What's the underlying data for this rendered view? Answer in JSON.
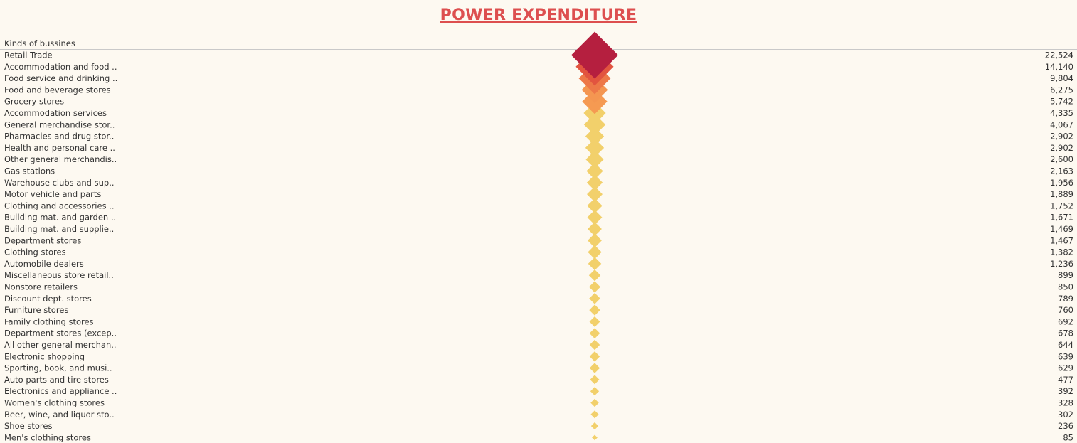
{
  "chart_data": {
    "type": "scatter",
    "title": "POWER EXPENDITURE",
    "column_header": "Kinds of bussines",
    "categories": [
      "Retail Trade",
      "Accommodation and food ..",
      "Food service and drinking ..",
      "Food and beverage stores",
      "Grocery stores",
      "Accommodation services",
      "General merchandise stor..",
      "Pharmacies and drug stor..",
      "Health and personal care ..",
      "Other general merchandis..",
      "Gas stations",
      "Warehouse clubs and sup..",
      "Motor vehicle and parts",
      "Clothing and accessories ..",
      "Building mat. and garden ..",
      "Building mat. and supplie..",
      "Department stores",
      "Clothing stores",
      "Automobile dealers",
      "Miscellaneous store retail..",
      "Nonstore retailers",
      "Discount dept. stores",
      "Furniture stores",
      "Family clothing stores",
      "Department stores (excep..",
      "All other general merchan..",
      "Electronic shopping",
      "Sporting, book, and  musi..",
      "Auto parts and tire stores",
      "Electronics and appliance ..",
      "Women's clothing stores",
      "Beer, wine, and liquor sto..",
      "Shoe stores",
      "Men's clothing stores"
    ],
    "values": [
      22524,
      14140,
      9804,
      6275,
      5742,
      4335,
      4067,
      2902,
      2902,
      2600,
      2163,
      1956,
      1889,
      1752,
      1671,
      1469,
      1467,
      1382,
      1236,
      899,
      850,
      789,
      760,
      692,
      678,
      644,
      639,
      629,
      477,
      392,
      328,
      302,
      236,
      85
    ],
    "value_labels": [
      "22,524",
      "14,140",
      "9,804",
      "6,275",
      "5,742",
      "4,335",
      "4,067",
      "2,902",
      "2,902",
      "2,600",
      "2,163",
      "1,956",
      "1,889",
      "1,752",
      "1,671",
      "1,469",
      "1,467",
      "1,382",
      "1,236",
      "899",
      "850",
      "789",
      "760",
      "692",
      "678",
      "644",
      "639",
      "629",
      "477",
      "392",
      "328",
      "302",
      "236",
      "85"
    ],
    "marker": "diamond",
    "size_encodes": "value",
    "color_scale": [
      "#f2d06b",
      "#f7a254",
      "#e5573f",
      "#b51f3f"
    ],
    "grid": false
  }
}
